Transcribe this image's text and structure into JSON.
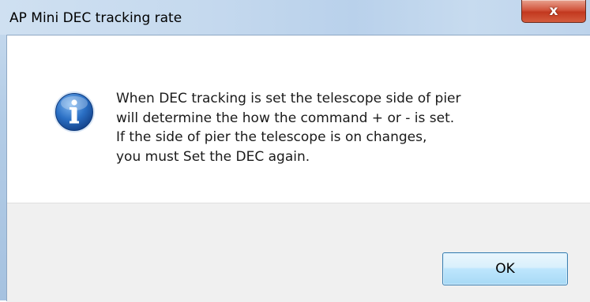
{
  "window": {
    "title": "AP Mini DEC tracking rate",
    "close_label": "x"
  },
  "message": {
    "icon": "info-icon",
    "lines": [
      "When DEC tracking is set the telescope side of pier",
      "will determine the how the command + or - is set.",
      "If the side of pier the telescope is on changes,",
      "you must Set the DEC again."
    ]
  },
  "buttons": {
    "ok_label": "OK"
  },
  "colors": {
    "titlebar": "#c5d9ee",
    "close_button": "#c2381f",
    "icon_blue": "#1f5fb4",
    "button_bar": "#f0f0f0",
    "ok_border": "#3c7fb1"
  }
}
